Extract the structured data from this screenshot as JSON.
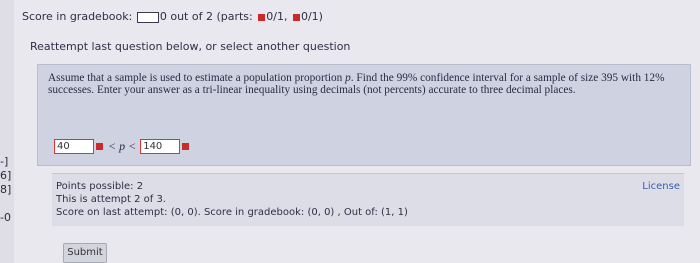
{
  "left_fragments": [
    "-]",
    "6]",
    "8]",
    "-0"
  ],
  "score": {
    "label": "Score in gradebook:",
    "value": "0 out of 2",
    "parts_open": "(parts:",
    "part1": "0/1,",
    "part2": "0/1)"
  },
  "reattempt_text": "Reattempt last question below, or select another question",
  "question": {
    "text_before_p": "Assume that a sample is used to estimate a population proportion ",
    "p_symbol": "p",
    "text_after_p": ". Find the 99% confidence interval for a sample of size 395 with 12% successes. Enter your answer as a tri-linear inequality using decimals (not percents) accurate to three decimal places.",
    "lower_value": "40",
    "inequality": "< p <",
    "upper_value": "140"
  },
  "info": {
    "points": "Points possible: 2",
    "attempt": "This is attempt 2 of 3.",
    "last_score": "Score on last attempt: (0, 0). Score in gradebook: (0, 0) , Out of: (1, 1)",
    "license": "License"
  },
  "submit_label": "Submit",
  "colors": {
    "error_red": "#c92a2a",
    "panel_bg": "#cfd3e1",
    "link_blue": "#3a5fa8"
  }
}
